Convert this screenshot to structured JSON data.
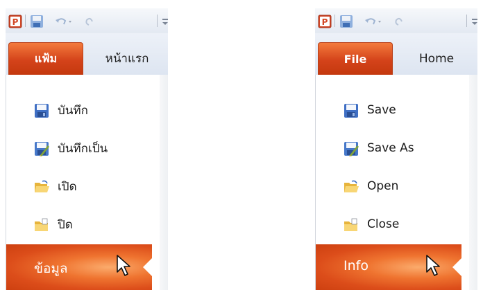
{
  "panels": [
    {
      "language": "thai",
      "tabs": {
        "file_label": "แฟ้ม",
        "home_label": "หน้าแรก"
      },
      "menu": {
        "save_label": "บันทึก",
        "save_as_label": "บันทึกเป็น",
        "open_label": "เปิด",
        "close_label": "ปิด",
        "info_label": "ข้อมูล"
      }
    },
    {
      "language": "english",
      "tabs": {
        "file_label": "File",
        "home_label": "Home"
      },
      "menu": {
        "save_label": "Save",
        "save_as_label": "Save As",
        "open_label": "Open",
        "close_label": "Close",
        "info_label": "Info"
      }
    }
  ],
  "colors": {
    "accent": "#d4431a",
    "info_highlight": "#ef7430",
    "text": "#1b1b1b"
  },
  "icons": [
    "powerpoint-logo-icon",
    "save-icon",
    "undo-icon",
    "redo-icon",
    "customize-icon",
    "save-as-icon",
    "open-folder-icon",
    "close-folder-icon",
    "mouse-pointer-icon"
  ]
}
